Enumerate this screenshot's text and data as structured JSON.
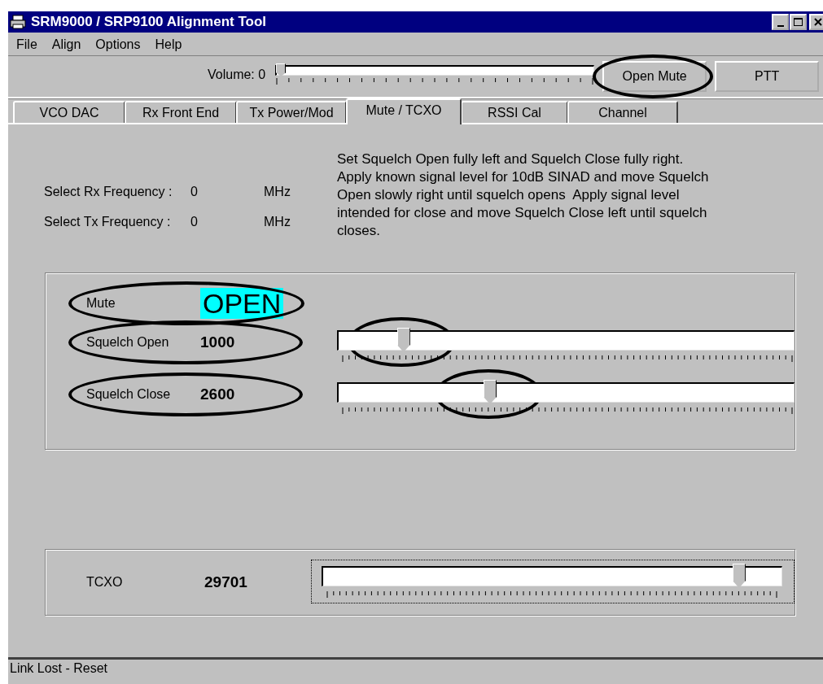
{
  "window": {
    "title": "SRM9000 / SRP9100 Alignment Tool"
  },
  "menu": [
    "File",
    "Align",
    "Options",
    "Help"
  ],
  "toolbar": {
    "volume": {
      "label": "Volume: 0",
      "level": 0
    },
    "buttons": [
      {
        "label": "Open Mute",
        "circled": true
      },
      {
        "label": "PTT",
        "circled": false
      }
    ]
  },
  "tabs": [
    {
      "label": "VCO DAC",
      "selected": false
    },
    {
      "label": "Rx Front End",
      "selected": false
    },
    {
      "label": "Tx Power/Mod",
      "selected": false
    },
    {
      "label": "Mute / TCXO",
      "selected": true
    },
    {
      "label": "RSSI Cal",
      "selected": false
    },
    {
      "label": "Channel",
      "selected": false
    }
  ],
  "frequencies": [
    {
      "label": "Select Rx Frequency :",
      "value": "0",
      "unit": "MHz"
    },
    {
      "label": "Select Tx Frequency :",
      "value": "0",
      "unit": "MHz"
    }
  ],
  "instructions": "Set Squelch Open fully left and Squelch Close fully right.  Apply known signal level for 10dB SINAD and move Squelch Open slowly right until squelch opens  Apply signal level intended for close and move Squelch Close left until squelch closes.",
  "mute_group": [
    {
      "kind": "status",
      "label": "Mute",
      "value": "OPEN",
      "circled": true
    },
    {
      "kind": "slider",
      "label": "Squelch Open",
      "value": "1000",
      "level": 0.13,
      "circled": true,
      "thumb_circled": true
    },
    {
      "kind": "slider",
      "label": "Squelch Close",
      "value": "2600",
      "level": 0.32,
      "circled": true,
      "thumb_circled": true
    }
  ],
  "tcxo": {
    "label": "TCXO",
    "value": "29701",
    "level": 0.895,
    "focused": true
  },
  "status_bar": "Link Lost - Reset"
}
